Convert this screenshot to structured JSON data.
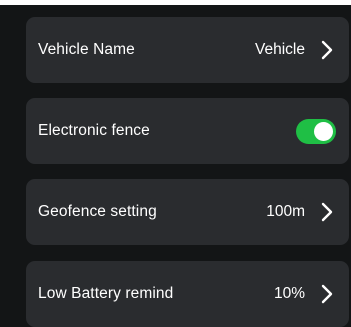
{
  "settings": {
    "vehicle_name": {
      "label": "Vehicle Name",
      "value": "Vehicle"
    },
    "electronic_fence": {
      "label": "Electronic fence",
      "enabled": true
    },
    "geofence_setting": {
      "label": "Geofence setting",
      "value": "100m"
    },
    "low_battery_remind": {
      "label": "Low Battery remind",
      "value": "10%"
    }
  },
  "colors": {
    "background": "#131516",
    "row_background": "#2a2c2f",
    "toggle_on": "#1fbf45",
    "text": "#ffffff"
  },
  "icons": {
    "row_arrow": "chevron-right-icon"
  }
}
